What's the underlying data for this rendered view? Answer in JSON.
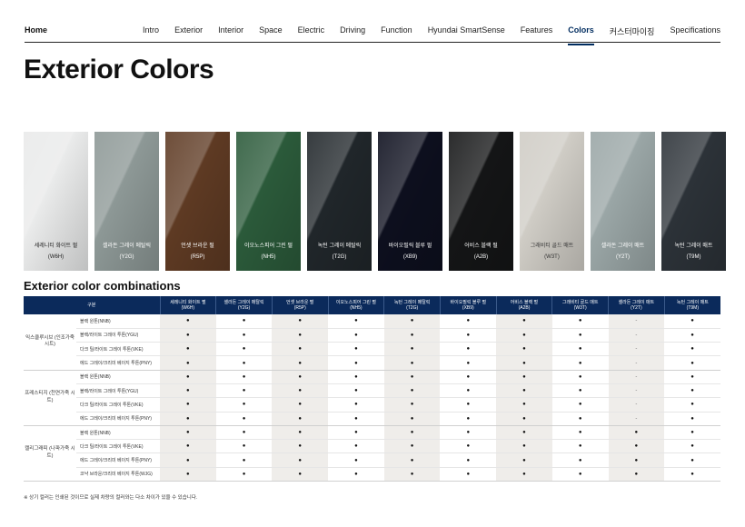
{
  "nav": {
    "home": "Home",
    "links": [
      "Intro",
      "Exterior",
      "Interior",
      "Space",
      "Electric",
      "Driving",
      "Function",
      "Hyundai SmartSense",
      "Features",
      "Colors",
      "커스터마이징",
      "Specifications"
    ],
    "active": "Colors"
  },
  "page_title": "Exterior Colors",
  "colors": [
    {
      "name": "세레니티 화이트 펄",
      "code": "(W6H)",
      "base": "#e9eaea",
      "text": "#222222"
    },
    {
      "name": "셀라돈 그레이 메탈릭",
      "code": "(Y2G)",
      "base": "#8d9896",
      "text": "#ffffff"
    },
    {
      "name": "언셋 브라운 펄",
      "code": "(R5P)",
      "base": "#5e3a23",
      "text": "#ffffff"
    },
    {
      "name": "이오노스피어 그린 펄",
      "code": "(NH5)",
      "base": "#2b5a3a",
      "text": "#ffffff"
    },
    {
      "name": "녹턴 그레이 메탈릭",
      "code": "(T2G)",
      "base": "#20262a",
      "text": "#ffffff"
    },
    {
      "name": "바이오필릭 블루 펄",
      "code": "(XB9)",
      "base": "#0d0f1e",
      "text": "#ffffff"
    },
    {
      "name": "어비스 블랙 펄",
      "code": "(A2B)",
      "base": "#141516",
      "text": "#ffffff"
    },
    {
      "name": "그래비티 골드 매트",
      "code": "(W3T)",
      "base": "#cfccc5",
      "text": "#333333"
    },
    {
      "name": "셀라돈 그레이 매트",
      "code": "(Y2T)",
      "base": "#9aa6a6",
      "text": "#ffffff"
    },
    {
      "name": "녹턴 그레이 매트",
      "code": "(T9M)",
      "base": "#2c3238",
      "text": "#ffffff"
    }
  ],
  "combinations": {
    "title": "Exterior color combinations",
    "header_label": "구분",
    "groups": [
      {
        "name": "익스클루시브 (인조가죽 시트)",
        "rows": [
          {
            "interior": "블랙 원톤(NNB)",
            "cells": [
              "●",
              "●",
              "●",
              "●",
              "●",
              "●",
              "●",
              "●",
              "-",
              "●"
            ]
          },
          {
            "interior": "블랙/라이트 그레이 투톤(YGU)",
            "cells": [
              "●",
              "●",
              "●",
              "●",
              "●",
              "●",
              "●",
              "●",
              "-",
              "●"
            ]
          },
          {
            "interior": "다크 틸/라이트 그레이 투톤(VKE)",
            "cells": [
              "●",
              "●",
              "●",
              "●",
              "●",
              "●",
              "●",
              "●",
              "-",
              "●"
            ]
          },
          {
            "interior": "에드 그레이/크리미 베이지 투톤(PNY)",
            "cells": [
              "●",
              "●",
              "●",
              "●",
              "●",
              "●",
              "●",
              "●",
              "-",
              "●"
            ]
          }
        ]
      },
      {
        "name": "프레스티지 (천연가죽 시트)",
        "rows": [
          {
            "interior": "블랙 원톤(NNB)",
            "cells": [
              "●",
              "●",
              "●",
              "●",
              "●",
              "●",
              "●",
              "●",
              "-",
              "●"
            ]
          },
          {
            "interior": "블랙/라이트 그레이 투톤(YGU)",
            "cells": [
              "●",
              "●",
              "●",
              "●",
              "●",
              "●",
              "●",
              "●",
              "-",
              "●"
            ]
          },
          {
            "interior": "다크 틸/라이트 그레이 투톤(VKE)",
            "cells": [
              "●",
              "●",
              "●",
              "●",
              "●",
              "●",
              "●",
              "●",
              "-",
              "●"
            ]
          },
          {
            "interior": "에드 그레이/크리미 베이지 투톤(PNY)",
            "cells": [
              "●",
              "●",
              "●",
              "●",
              "●",
              "●",
              "●",
              "●",
              "-",
              "●"
            ]
          }
        ]
      },
      {
        "name": "캘리그래피 (나파가죽 시트)",
        "rows": [
          {
            "interior": "블랙 원톤(NNB)",
            "cells": [
              "●",
              "●",
              "●",
              "●",
              "●",
              "●",
              "●",
              "●",
              "●",
              "●"
            ]
          },
          {
            "interior": "다크 틸/라이트 그레이 투톤(VKE)",
            "cells": [
              "●",
              "●",
              "●",
              "●",
              "●",
              "●",
              "●",
              "●",
              "●",
              "●"
            ]
          },
          {
            "interior": "에드 그레이/크리미 베이지 투톤(PNY)",
            "cells": [
              "●",
              "●",
              "●",
              "●",
              "●",
              "●",
              "●",
              "●",
              "●",
              "●"
            ]
          },
          {
            "interior": "코냑 브라운/크리미 베이지 투톤(WJG)",
            "cells": [
              "●",
              "●",
              "●",
              "●",
              "●",
              "●",
              "●",
              "●",
              "●",
              "●"
            ]
          }
        ]
      }
    ]
  },
  "footnote": "※ 상기 컬러는 인쇄된 것이므로 실제 차량의 컬러와는 다소 차이가 있을 수 있습니다."
}
